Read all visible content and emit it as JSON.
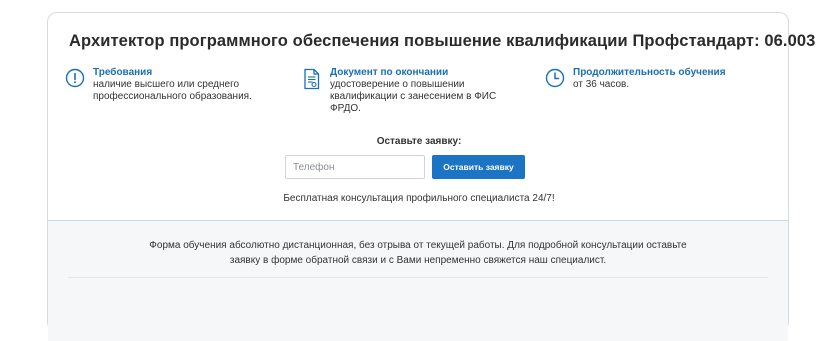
{
  "course": {
    "title": "Архитектор программного обеспечения повышение квалификации Профстандарт: 06.003"
  },
  "features": [
    {
      "icon": "exclamation-circle-icon",
      "heading": "Требования",
      "text": "наличие высшего или среднего профессионального образования."
    },
    {
      "icon": "document-icon",
      "heading": "Документ по окончании",
      "text": "удостоверение о повышении квалификации с занесением в ФИС ФРДО."
    },
    {
      "icon": "clock-icon",
      "heading": "Продолжительность обучения",
      "text": "от 36 часов."
    }
  ],
  "form": {
    "label": "Оставьте заявку:",
    "phone_placeholder": "Телефон",
    "submit_label": "Оставить заявку",
    "consultation_note": "Бесплатная консультация профильного специалиста 24/7!"
  },
  "lower": {
    "text": "Форма обучения абсолютно дистанционная, без отрыва от текущей работы. Для подробной консультации оставьте заявку в форме обратной связи и с Вами непременно свяжется наш специалист."
  },
  "colors": {
    "accent": "#1a6fb5",
    "button": "#1c74c4",
    "border": "#d6dbe1",
    "lower_bg": "#f6f7f8"
  }
}
